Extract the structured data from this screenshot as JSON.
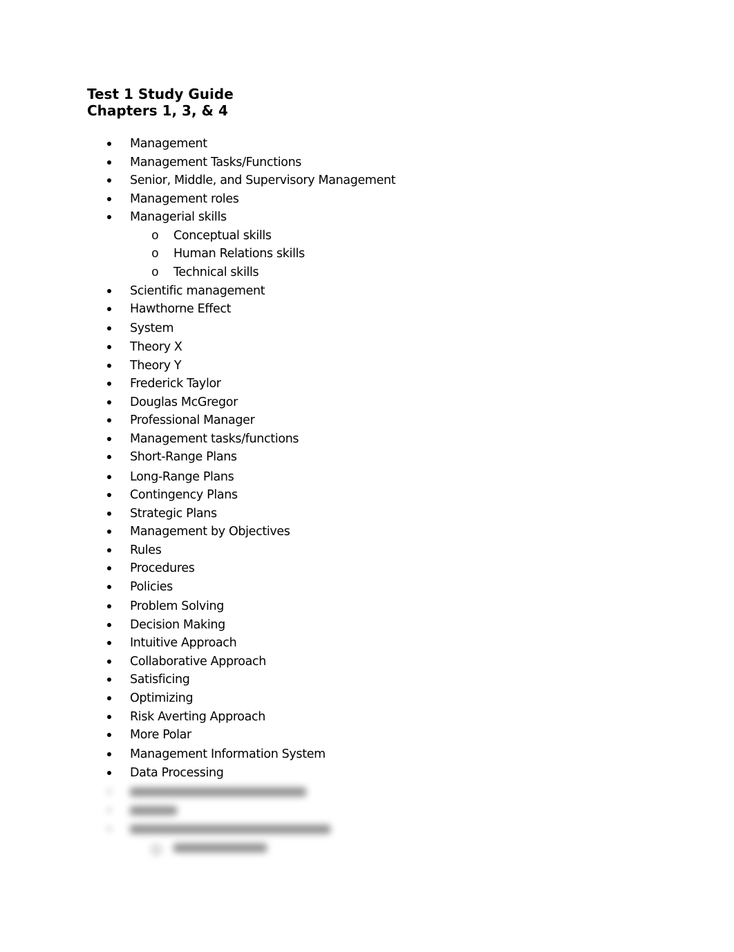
{
  "document": {
    "title_line1": "Test 1 Study Guide",
    "title_line2": "Chapters 1, 3, & 4",
    "bullet_glyph": "bullet-dot",
    "sub_bullet_glyph": "o",
    "items": [
      {
        "label": "Management"
      },
      {
        "label": "Management Tasks/Functions"
      },
      {
        "label": "Senior, Middle, and Supervisory Management"
      },
      {
        "label": "Management roles"
      },
      {
        "label": "Managerial skills"
      },
      {
        "label": "Conceptual skills",
        "level": 2
      },
      {
        "label": "Human Relations skills",
        "level": 2
      },
      {
        "label": "Technical skills",
        "level": 2
      },
      {
        "label": "Scientific management"
      },
      {
        "label": "Hawthorne Effect"
      },
      {
        "label": "System"
      },
      {
        "label": "Theory X"
      },
      {
        "label": "Theory Y"
      },
      {
        "label": "Frederick Taylor"
      },
      {
        "label": "Douglas McGregor"
      },
      {
        "label": "Professional Manager"
      },
      {
        "label": "Management tasks/functions"
      },
      {
        "label": "Short-Range Plans"
      },
      {
        "label": "Long-Range Plans"
      },
      {
        "label": "Contingency Plans"
      },
      {
        "label": "Strategic Plans"
      },
      {
        "label": "Management by Objectives"
      },
      {
        "label": "Rules"
      },
      {
        "label": "Procedures"
      },
      {
        "label": "Policies"
      },
      {
        "label": "Problem Solving"
      },
      {
        "label": "Decision Making"
      },
      {
        "label": "Intuitive Approach"
      },
      {
        "label": "Collaborative Approach"
      },
      {
        "label": "Satisficing"
      },
      {
        "label": "Optimizing"
      },
      {
        "label": "Risk Averting Approach"
      },
      {
        "label": "More Polar"
      },
      {
        "label": "Management Information System"
      },
      {
        "label": "Data Processing"
      }
    ],
    "blurred_items_note": "Remaining items are blurred/obscured and not legible"
  }
}
